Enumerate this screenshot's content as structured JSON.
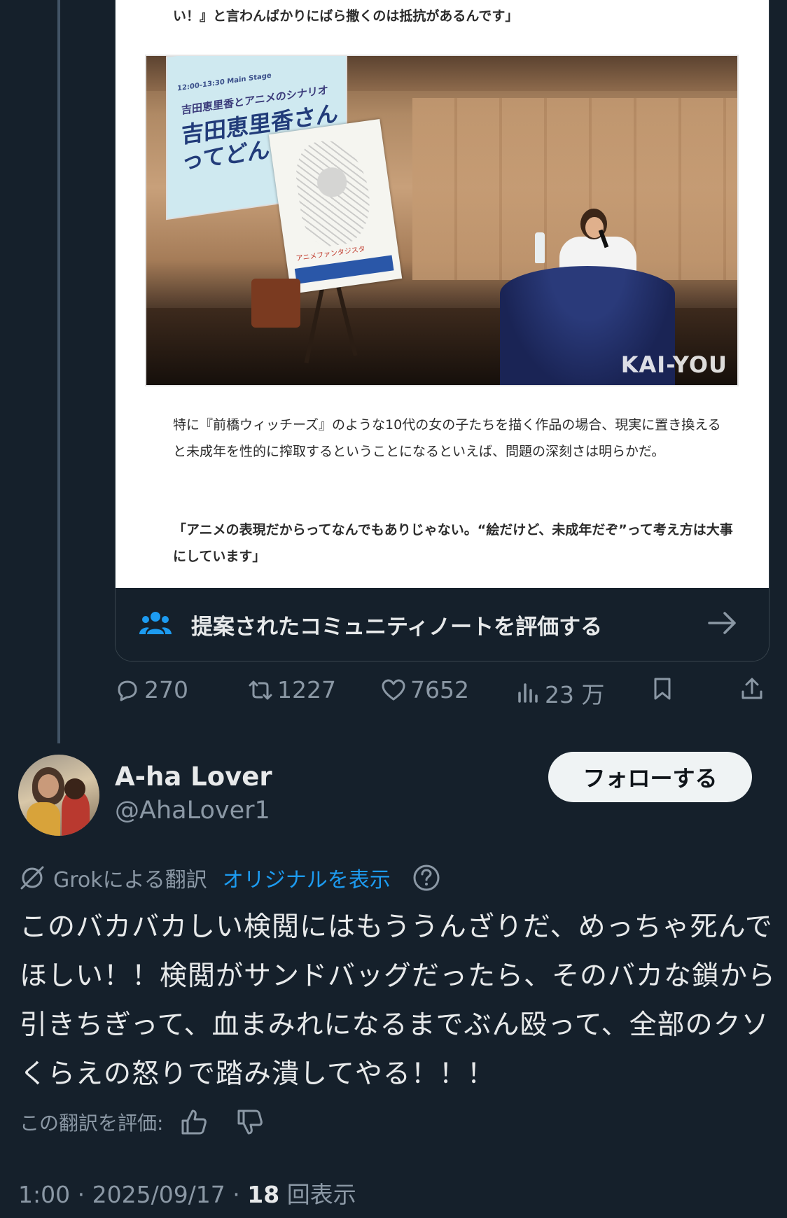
{
  "article": {
    "line_top": "い！』と言わんばかりにばら撒くのは抵抗があるんです」",
    "paragraph": "特に『前橋ウィッチーズ』のような10代の女の子たちを描く作品の場合、現実に置き換えると未成年を性的に搾取するということになるといえば、問題の深刻さは明らかだ。",
    "quote": "「アニメの表現だからってなんでもありじゃない。“絵だけど、未成年だぞ”って考え方は大事にしています」",
    "photo": {
      "screen_small": "12:00-13:30 Main Stage",
      "screen_mid": "吉田恵里香とアニメのシナリオ",
      "screen_title": "吉田恵里香さんってどんな人？",
      "poster_text": "アニメファンタジスタ",
      "watermark": "KAI-YOU"
    }
  },
  "community_note": {
    "label": "提案されたコミュニティノートを評価する",
    "icon": "people-icon",
    "arrow_icon": "arrow-right-icon"
  },
  "actions": {
    "replies": "270",
    "reposts": "1227",
    "likes": "7652",
    "views": "23 万"
  },
  "reply": {
    "name": "A-ha Lover",
    "handle": "@AhaLover1",
    "follow_label": "フォローする",
    "grok_label": "Grokによる翻訳",
    "show_original": "オリジナルを表示",
    "text": "このバカバカしい検閲にはもううんざりだ、めっちゃ死んでほしい！！検閲がサンドバッグだったら、そのバカな鎖から引きちぎって、血まみれになるまでぶん殴って、全部のクソくらえの怒りで踏み潰してやる！！！",
    "rate_label": "この翻訳を評価:",
    "time": "1:00",
    "date": "2025/09/17",
    "views_count": "18",
    "views_label": "回表示"
  },
  "colors": {
    "background": "#15202b",
    "accent": "#1d9bf0",
    "muted": "#8b98a5",
    "text": "#e7e9ea"
  }
}
